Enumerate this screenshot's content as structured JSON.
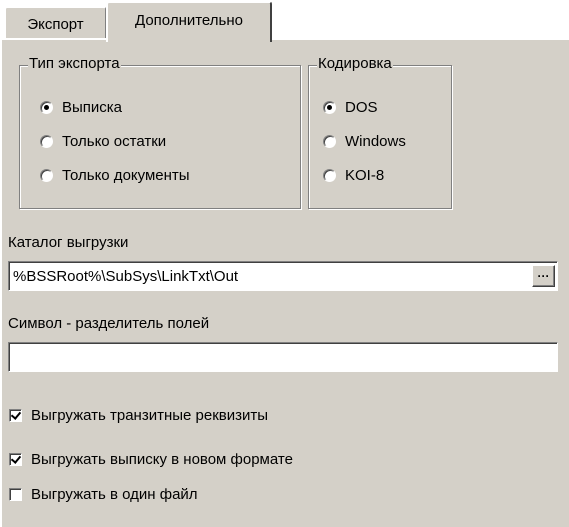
{
  "tabs": {
    "export_label": "Экспорт",
    "advanced_label": "Дополнительно"
  },
  "export_type": {
    "title": "Тип экспорта",
    "options": [
      {
        "label": "Выписка",
        "selected": true
      },
      {
        "label": "Только остатки",
        "selected": false
      },
      {
        "label": "Только документы",
        "selected": false
      }
    ]
  },
  "encoding": {
    "title": "Кодировка",
    "options": [
      {
        "label": "DOS",
        "selected": true
      },
      {
        "label": "Windows",
        "selected": false
      },
      {
        "label": "KOI-8",
        "selected": false
      }
    ]
  },
  "output_dir": {
    "label": "Каталог выгрузки",
    "value": "%BSSRoot%\\SubSys\\LinkTxt\\Out",
    "browse_label": "···"
  },
  "separator": {
    "label": "Символ - разделитель полей",
    "value": ""
  },
  "options": [
    {
      "label": "Выгружать транзитные реквизиты",
      "checked": true
    },
    {
      "label": "Выгружать выписку в новом формате",
      "checked": true
    },
    {
      "label": "Выгружать в один файл",
      "checked": false
    }
  ]
}
